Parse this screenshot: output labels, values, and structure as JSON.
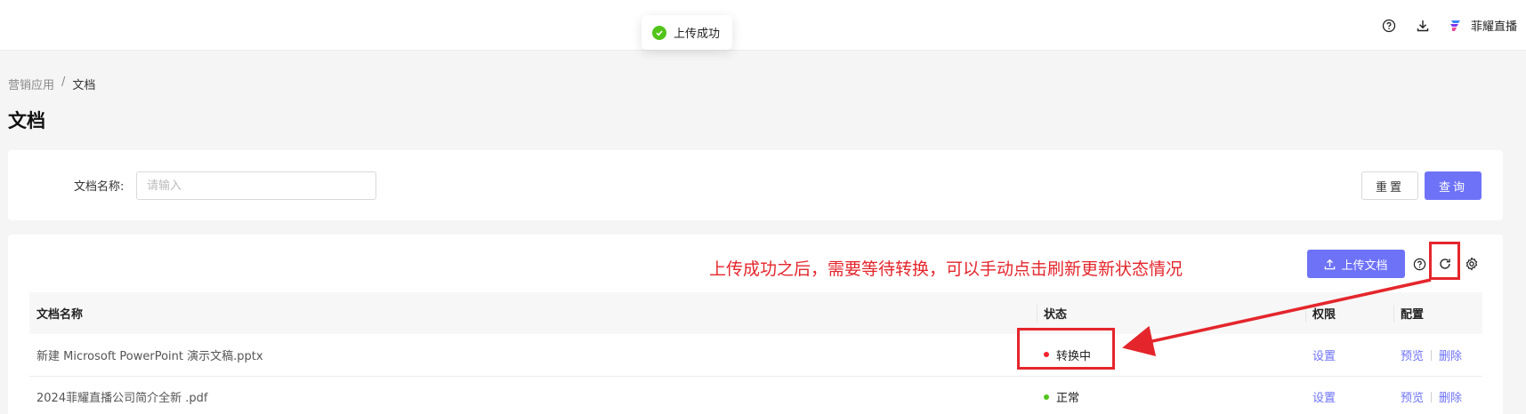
{
  "toast": {
    "message": "上传成功"
  },
  "header": {
    "brand_name": "菲耀直播",
    "icons": [
      "help-icon",
      "download-icon",
      "brand-logo"
    ]
  },
  "breadcrumb": {
    "parent": "营销应用",
    "separator": "/",
    "current": "文档"
  },
  "page": {
    "title": "文档"
  },
  "search": {
    "label": "文档名称:",
    "placeholder": "请输入",
    "value": "",
    "reset_label": "重置",
    "query_label": "查询"
  },
  "toolbar": {
    "upload_label": "上传文档",
    "icons": [
      "help-icon",
      "refresh-icon",
      "settings-icon"
    ]
  },
  "annotation": {
    "text": "上传成功之后，需要等待转换，可以手动点击刷新更新状态情况",
    "color": "#e4262c"
  },
  "table": {
    "columns": [
      "文档名称",
      "状态",
      "权限",
      "配置"
    ],
    "rows": [
      {
        "name": "新建 Microsoft PowerPoint 演示文稿.pptx",
        "status": "转换中",
        "status_color": "#f5222d",
        "permission": "设置",
        "preview": "预览",
        "delete": "删除"
      },
      {
        "name": "2024菲耀直播公司简介全新 .pdf",
        "status": "正常",
        "status_color": "#52c41a",
        "permission": "设置",
        "preview": "预览",
        "delete": "删除"
      }
    ]
  },
  "colors": {
    "primary": "#6e72f7",
    "annotation": "#e4262c",
    "success": "#52c41a"
  }
}
